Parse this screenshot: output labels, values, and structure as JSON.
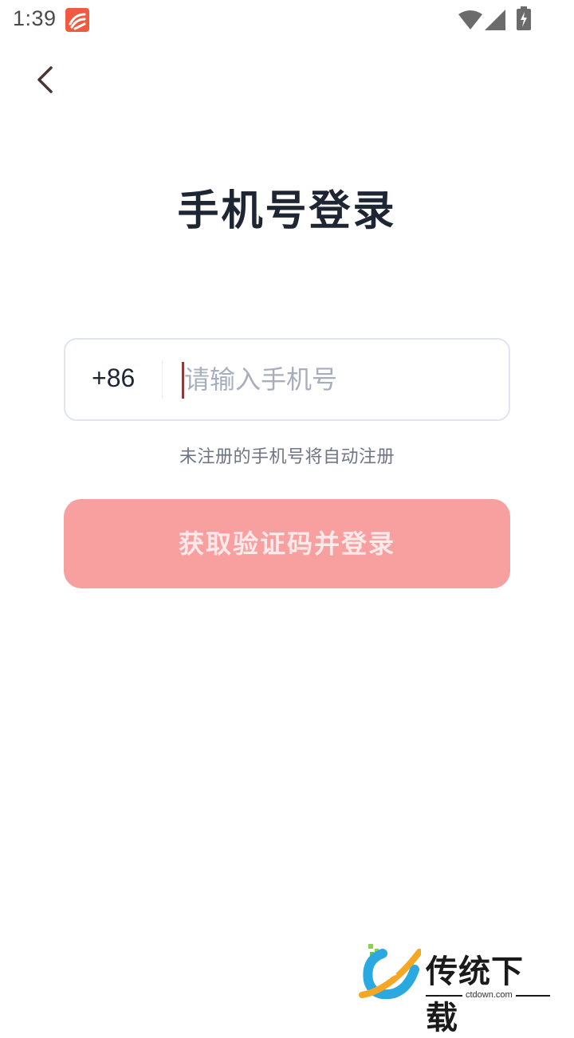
{
  "status_bar": {
    "time": "1:39",
    "notification_icon": "app-notification-icon",
    "wifi_icon": "wifi-icon",
    "signal_icon": "cell-signal-icon",
    "battery_icon": "battery-charging-icon"
  },
  "nav": {
    "back_icon": "chevron-left-icon"
  },
  "title": "手机号登录",
  "phone_input": {
    "country_code": "+86",
    "placeholder": "请输入手机号",
    "value": ""
  },
  "hint": "未注册的手机号将自动注册",
  "login_button": {
    "label": "获取验证码并登录"
  },
  "watermark": {
    "title": "传统下载",
    "domain": "ctdown.com"
  },
  "colors": {
    "title": "#1e2533",
    "button_bg": "#f8a0a0",
    "button_text": "#fde9e9",
    "placeholder": "#a8aebb",
    "cursor": "#8c3a3a",
    "input_border": "#e2e5ee"
  }
}
